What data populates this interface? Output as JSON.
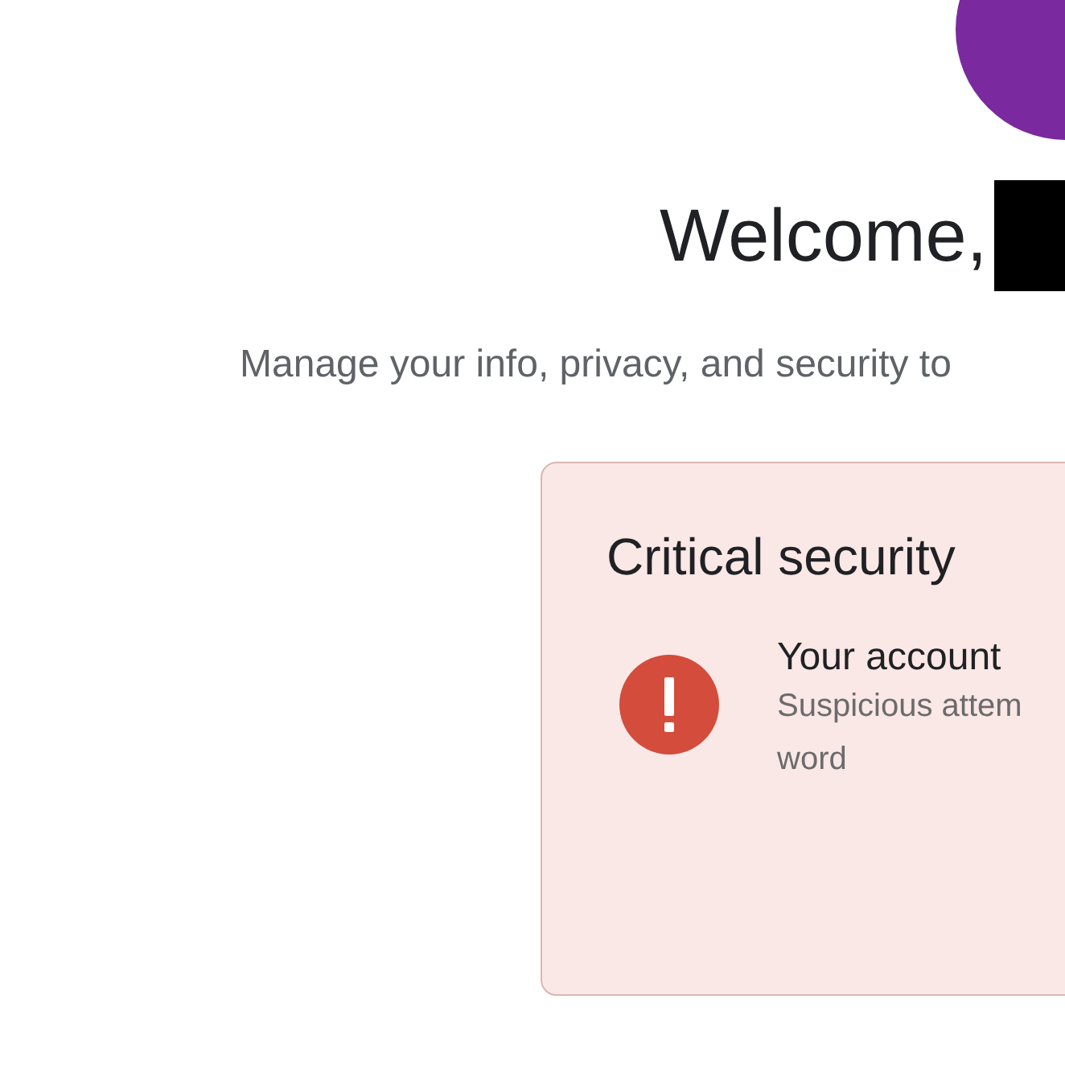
{
  "greeting": "Welcome,",
  "subtitle": "Manage your info, privacy, and security to",
  "alert_card": {
    "title": "Critical security",
    "items": [
      {
        "kind": "critical",
        "title": "Your account",
        "lines": [
          "Suspicious attem",
          "word"
        ]
      }
    ]
  }
}
